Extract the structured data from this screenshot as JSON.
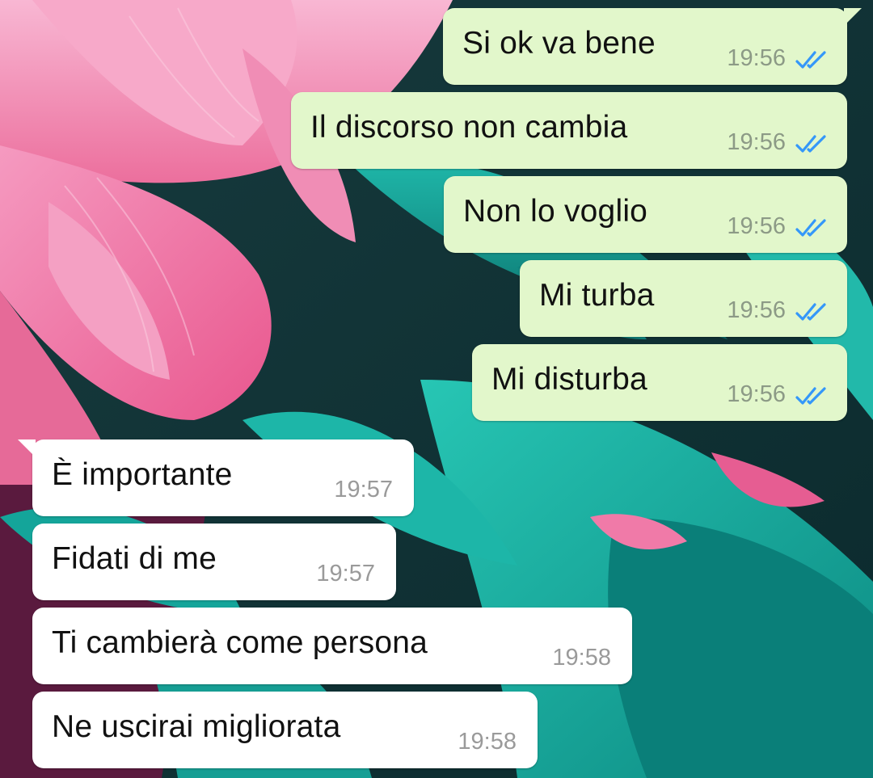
{
  "colors": {
    "outgoing_bubble": "#e2f7cb",
    "incoming_bubble": "#ffffff",
    "read_ticks": "#3497f9"
  },
  "messages_out": [
    {
      "text": "Si ok va bene",
      "time": "19:56",
      "status_icon": "double-check-read-icon"
    },
    {
      "text": "Il discorso non cambia",
      "time": "19:56",
      "status_icon": "double-check-read-icon"
    },
    {
      "text": "Non lo voglio",
      "time": "19:56",
      "status_icon": "double-check-read-icon"
    },
    {
      "text": "Mi turba",
      "time": "19:56",
      "status_icon": "double-check-read-icon"
    },
    {
      "text": "Mi disturba",
      "time": "19:56",
      "status_icon": "double-check-read-icon"
    }
  ],
  "messages_in": [
    {
      "text": "È importante",
      "time": "19:57"
    },
    {
      "text": "Fidati di me",
      "time": "19:57"
    },
    {
      "text": "Ti cambierà come persona",
      "time": "19:58"
    },
    {
      "text": "Ne uscirai migliorata",
      "time": "19:58"
    }
  ]
}
